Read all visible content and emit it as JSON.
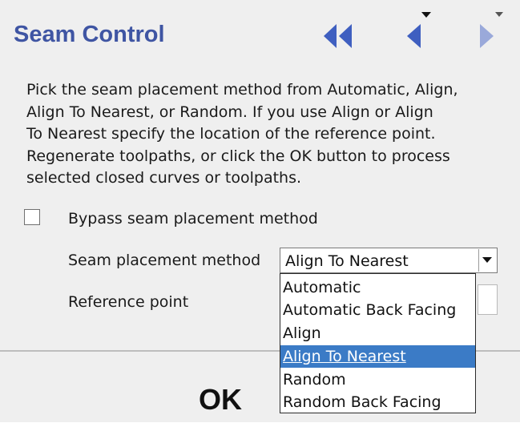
{
  "header": {
    "title": "Seam Control",
    "nav_icons": [
      "double-left-arrow-icon",
      "left-arrow-icon",
      "right-arrow-icon"
    ]
  },
  "description": "Pick the seam placement method from Automatic, Align,\nAlign To Nearest, or Random. If you use Align or Align\nTo Nearest specify the location of the reference point.\nRegenerate toolpaths, or click the OK button to process\nselected closed curves or toolpaths.",
  "bypass": {
    "label": "Bypass seam placement method",
    "checked": false
  },
  "seam_method": {
    "label": "Seam placement method",
    "value": "Align To Nearest",
    "options": [
      "Automatic",
      "Automatic Back Facing",
      "Align",
      "Align To Nearest",
      "Random",
      "Random Back Facing"
    ],
    "selected_index": 3
  },
  "reference_point": {
    "label": "Reference point"
  },
  "ok_button": {
    "label": "OK"
  },
  "colors": {
    "title": "#3f55a3",
    "nav_icon": "#3f5fc0",
    "nav_icon_disabled": "#9aa9da",
    "selection": "#3b7bc6",
    "panel_background": "#efefef"
  }
}
